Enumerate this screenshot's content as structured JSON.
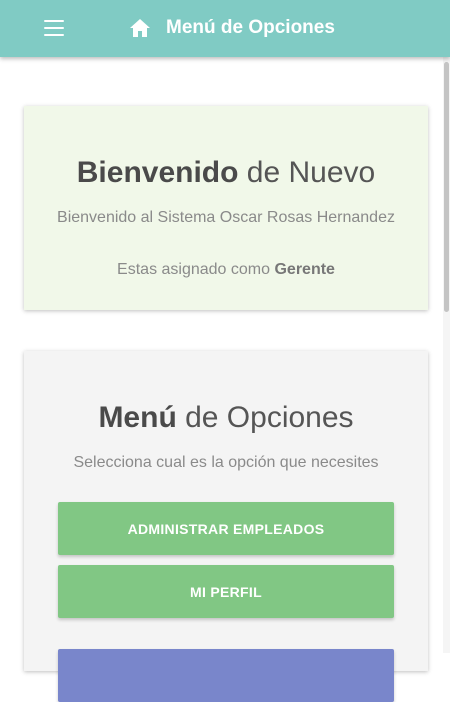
{
  "header": {
    "title": "Menú de Opciones",
    "background": "#80cbc4",
    "menu_icon": "hamburger-menu-icon",
    "home_icon": "home-icon"
  },
  "welcome": {
    "title_bold": "Bienvenido",
    "title_rest": " de Nuevo",
    "subtitle": "Bienvenido al Sistema Oscar Rosas Hernandez",
    "role_prefix": "Estas asignado como ",
    "role": "Gerente",
    "background": "#f1f8e9"
  },
  "menu": {
    "title_bold": "Menú",
    "title_rest": " de Opciones",
    "subtitle": "Selecciona cual es la opción que necesites",
    "buttons": [
      {
        "label": "ADMINISTRAR EMPLEADOS",
        "color": "#81c784"
      },
      {
        "label": "MI PERFIL",
        "color": "#81c784"
      },
      {
        "label": "",
        "color": "#7986cb"
      }
    ]
  }
}
